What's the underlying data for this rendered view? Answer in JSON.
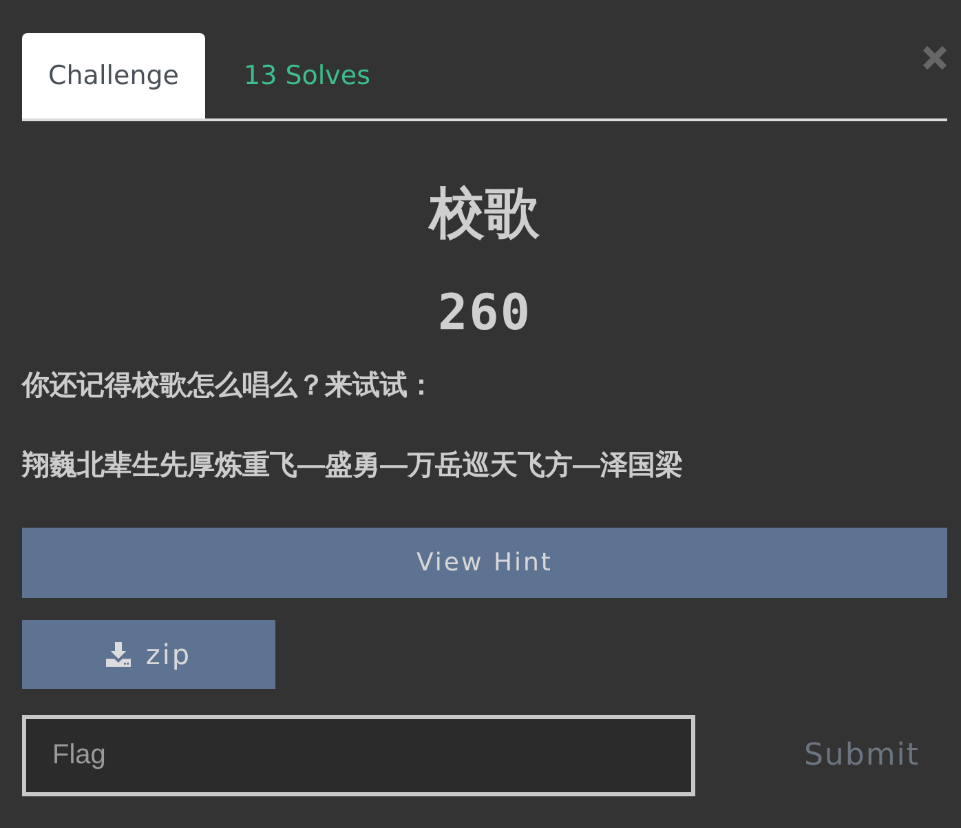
{
  "tabs": [
    {
      "label": "Challenge",
      "selected": true
    },
    {
      "label": "13 Solves",
      "selected": false
    }
  ],
  "challenge": {
    "name": "校歌",
    "points": "260",
    "description": [
      "你还记得校歌怎么唱么？来试试：",
      "翔巍北辈生先厚炼重飞—盛勇—万岳巡天飞方—泽国梁"
    ]
  },
  "hint_button": "View Hint",
  "file_button": "zip",
  "flag_field": {
    "placeholder": "Flag"
  },
  "submit_button": "Submit"
}
